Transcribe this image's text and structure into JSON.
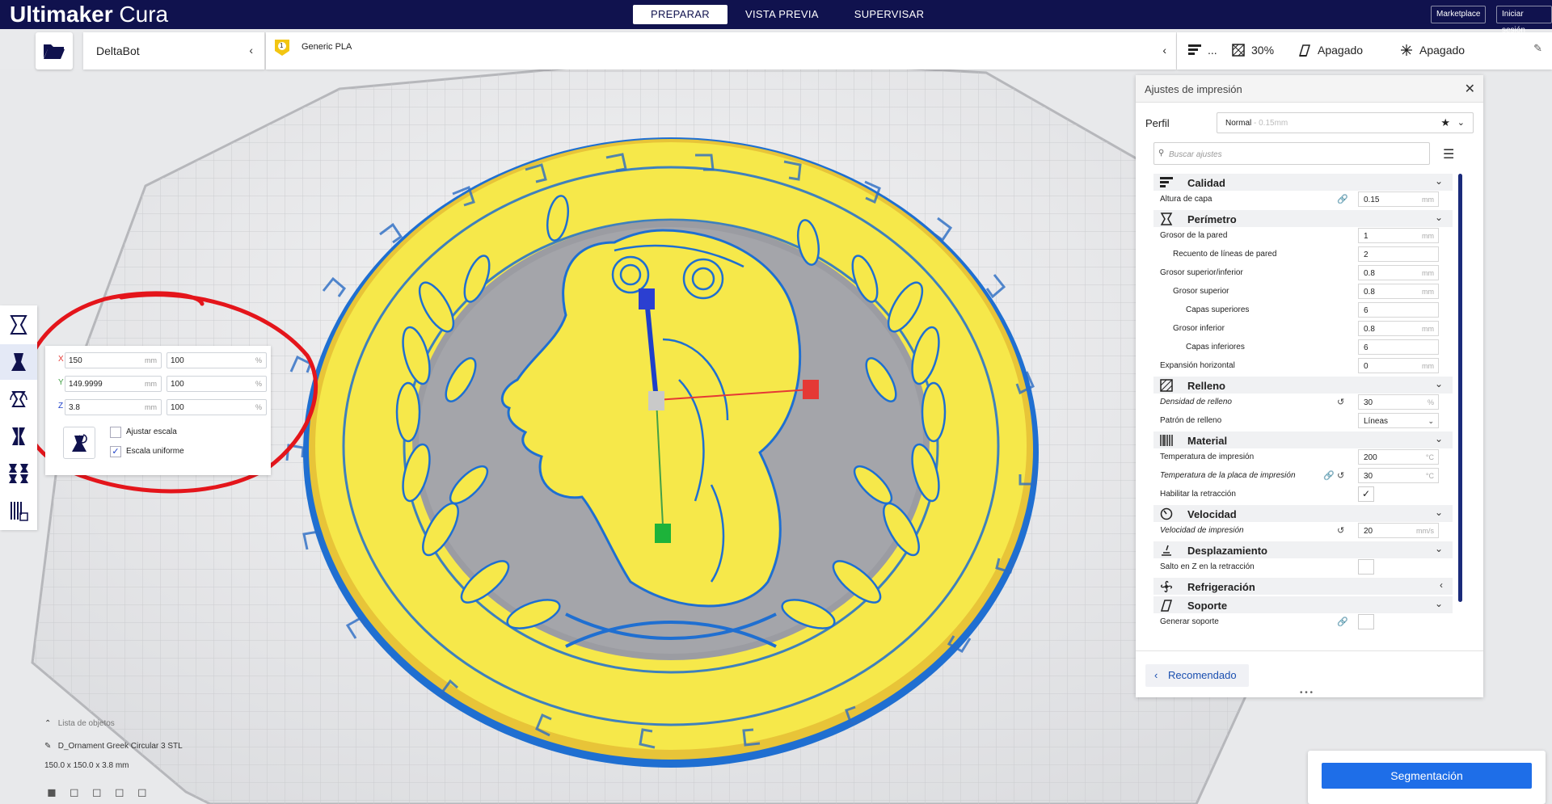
{
  "app": {
    "brand": "Ultimaker",
    "product": "Cura"
  },
  "stages": [
    {
      "label": "PREPARAR",
      "active": true
    },
    {
      "label": "VISTA PREVIA",
      "active": false
    },
    {
      "label": "SUPERVISAR",
      "active": false
    }
  ],
  "header_buttons": {
    "marketplace": "Marketplace",
    "login": "Iniciar sesión"
  },
  "printer": {
    "name": "DeltaBot"
  },
  "material": {
    "extruder": "1",
    "name": "Generic PLA"
  },
  "print_summary": {
    "profile_short": "...",
    "infill": "30%",
    "support": "Apagado",
    "adhesion": "Apagado"
  },
  "scale_tool": {
    "rows": [
      {
        "axis": "X",
        "mm": "150",
        "percent": "100",
        "axis_color": "#e53935"
      },
      {
        "axis": "Y",
        "mm": "149.9999",
        "percent": "100",
        "axis_color": "#43a047"
      },
      {
        "axis": "Z",
        "mm": "3.8",
        "percent": "100",
        "axis_color": "#1e40c8"
      }
    ],
    "unit_mm": "mm",
    "unit_percent": "%",
    "snap_label": "Ajustar escala",
    "uniform_label": "Escala uniforme",
    "uniform_checked": true
  },
  "settings_panel": {
    "title": "Ajustes de impresión",
    "profile_label": "Perfil",
    "profile_value": "Normal",
    "profile_sub": "- 0.15mm",
    "search_placeholder": "Buscar ajustes",
    "categories": {
      "calidad": "Calidad",
      "perimetro": "Perímetro",
      "relleno": "Relleno",
      "material": "Material",
      "velocidad": "Velocidad",
      "desplazamiento": "Desplazamiento",
      "refrigeracion": "Refrigeración",
      "soporte": "Soporte"
    },
    "settings": {
      "layer_height": {
        "label": "Altura de capa",
        "value": "0.15",
        "unit": "mm"
      },
      "wall_thickness": {
        "label": "Grosor de la pared",
        "value": "1",
        "unit": "mm"
      },
      "wall_line_count": {
        "label": "Recuento de líneas de pared",
        "value": "2",
        "unit": ""
      },
      "top_bottom_thickness": {
        "label": "Grosor superior/inferior",
        "value": "0.8",
        "unit": "mm"
      },
      "top_thickness": {
        "label": "Grosor superior",
        "value": "0.8",
        "unit": "mm"
      },
      "top_layers": {
        "label": "Capas superiores",
        "value": "6",
        "unit": ""
      },
      "bottom_thickness": {
        "label": "Grosor inferior",
        "value": "0.8",
        "unit": "mm"
      },
      "bottom_layers": {
        "label": "Capas inferiores",
        "value": "6",
        "unit": ""
      },
      "horizontal_expansion": {
        "label": "Expansión horizontal",
        "value": "0",
        "unit": "mm"
      },
      "infill_density": {
        "label": "Densidad de relleno",
        "value": "30",
        "unit": "%"
      },
      "infill_pattern": {
        "label": "Patrón de relleno",
        "value": "Líneas"
      },
      "print_temp": {
        "label": "Temperatura de impresión",
        "value": "200",
        "unit": "°C"
      },
      "bed_temp": {
        "label": "Temperatura de la placa de impresión",
        "value": "30",
        "unit": "°C"
      },
      "retraction": {
        "label": "Habilitar la retracción",
        "checked": true
      },
      "print_speed": {
        "label": "Velocidad de impresión",
        "value": "20",
        "unit": "mm/s"
      },
      "z_hop": {
        "label": "Salto en Z en la retracción",
        "checked": false
      },
      "generate_support": {
        "label": "Generar soporte",
        "checked": false
      }
    },
    "recommended_label": "Recomendado"
  },
  "slice_button": "Segmentación",
  "object_list": {
    "header": "Lista de objetos",
    "file": "D_Ornament Greek Circular 3 STL",
    "dimensions": "150.0 x 150.0 x 3.8 mm"
  },
  "colors": {
    "header_bg": "#10124e",
    "model_yellow": "#f6e84a",
    "model_outline": "#1f6fd1",
    "accent_blue": "#1e6ee8",
    "annotation_red": "#e4151b"
  }
}
